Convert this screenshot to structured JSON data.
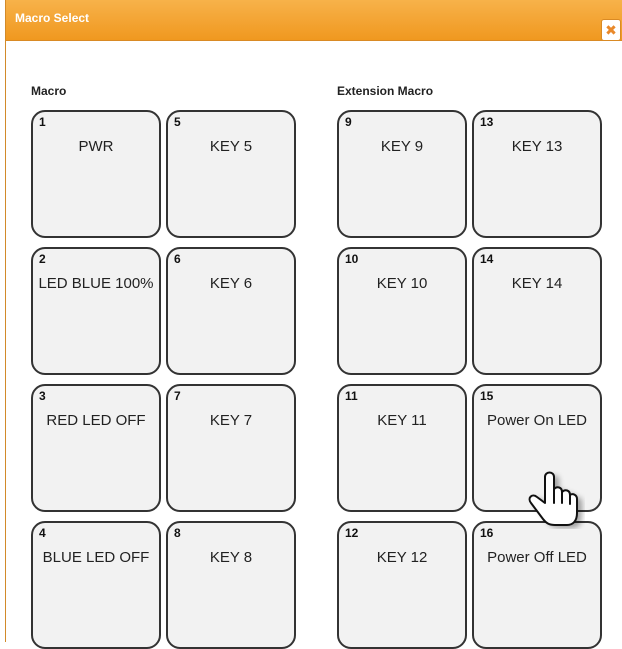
{
  "dialog": {
    "title": "Macro Select",
    "close_symbol": "✖"
  },
  "sections": {
    "macro_label": "Macro",
    "extension_label": "Extension Macro"
  },
  "macros": {
    "m1": {
      "num": "1",
      "name": "PWR"
    },
    "m2": {
      "num": "2",
      "name": "LED BLUE 100%"
    },
    "m3": {
      "num": "3",
      "name": "RED LED OFF"
    },
    "m4": {
      "num": "4",
      "name": "BLUE LED OFF"
    },
    "m5": {
      "num": "5",
      "name": "KEY 5"
    },
    "m6": {
      "num": "6",
      "name": "KEY 6"
    },
    "m7": {
      "num": "7",
      "name": "KEY 7"
    },
    "m8": {
      "num": "8",
      "name": "KEY 8"
    },
    "m9": {
      "num": "9",
      "name": "KEY 9"
    },
    "m10": {
      "num": "10",
      "name": "KEY 10"
    },
    "m11": {
      "num": "11",
      "name": "KEY 11"
    },
    "m12": {
      "num": "12",
      "name": "KEY 12"
    },
    "m13": {
      "num": "13",
      "name": "KEY 13"
    },
    "m14": {
      "num": "14",
      "name": "KEY 14"
    },
    "m15": {
      "num": "15",
      "name": "Power On LED"
    },
    "m16": {
      "num": "16",
      "name": "Power Off LED"
    }
  },
  "icons": {
    "close": "close-icon",
    "cursor": "hand-pointer-icon"
  },
  "colors": {
    "titlebar": "#f0981f",
    "button_fill": "#f2f2f2",
    "button_border": "#333333"
  }
}
